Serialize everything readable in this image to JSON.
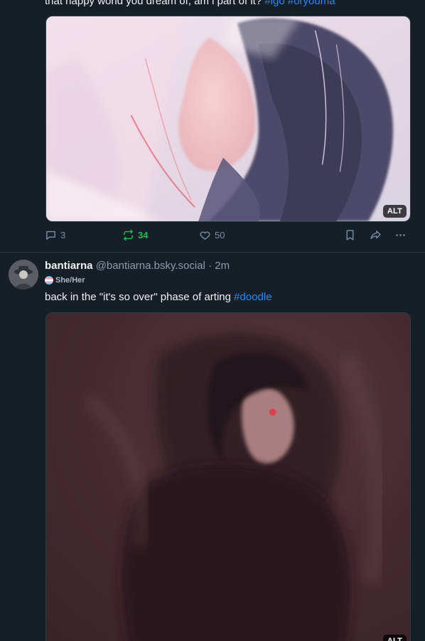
{
  "post_top": {
    "text": "that happy world you dream of, am i part of it?",
    "hashtags": [
      "#lgo",
      "#oryouma"
    ],
    "image_alt_badge": "ALT",
    "actions": {
      "replies": "3",
      "reposts": "34",
      "likes": "50"
    },
    "icons": [
      "reply-icon",
      "repost-icon",
      "like-icon",
      "bookmark-icon",
      "share-icon",
      "more-icon"
    ]
  },
  "post_bottom": {
    "display_name": "bantiarna",
    "handle": "@bantiarna.bsky.social",
    "separator": "·",
    "time": "2m",
    "pronouns": "She/Her",
    "text": "back in the \"it's so over\" phase of arting",
    "hashtag": "#doodle",
    "image_alt_badge": "ALT"
  },
  "colors": {
    "background": "#161e27",
    "text": "#f1f3f5",
    "muted": "#788ea5",
    "link": "#208bfe",
    "repost_active": "#19c24f",
    "divider": "#2e3a48"
  }
}
